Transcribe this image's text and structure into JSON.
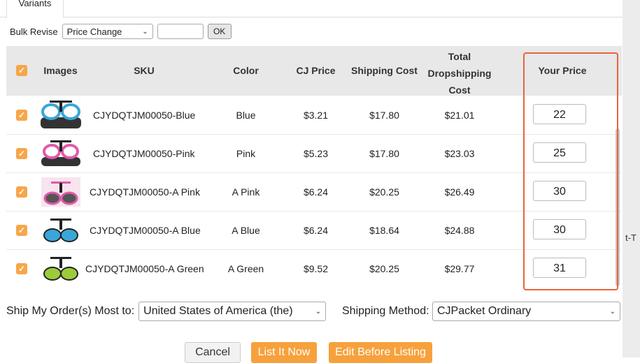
{
  "tabs": [
    {
      "label": "Variants"
    }
  ],
  "bulk": {
    "label": "Bulk Revise",
    "select_value": "Price Change",
    "input_value": "",
    "ok_label": "OK"
  },
  "table": {
    "headers": {
      "images": "Images",
      "sku": "SKU",
      "color": "Color",
      "cj_price": "CJ Price",
      "shipping_cost": "Shipping Cost",
      "total_line1": "Total",
      "total_line2": "Dropshipping",
      "total_line3": "Cost",
      "your_price": "Your Price"
    },
    "rows": [
      {
        "sku": "CJYDQTJM00050-Blue",
        "color": "Blue",
        "cj_price": "$3.21",
        "shipping": "$17.80",
        "total": "$21.01",
        "your_price": "22",
        "tint": "#3aa6d8"
      },
      {
        "sku": "CJYDQTJM00050-Pink",
        "color": "Pink",
        "cj_price": "$5.23",
        "shipping": "$17.80",
        "total": "$23.03",
        "your_price": "25",
        "tint": "#e05aa8"
      },
      {
        "sku": "CJYDQTJM00050-A Pink",
        "color": "A Pink",
        "cj_price": "$6.24",
        "shipping": "$20.25",
        "total": "$26.49",
        "your_price": "30",
        "tint": "#e05aa8"
      },
      {
        "sku": "CJYDQTJM00050-A Blue",
        "color": "A Blue",
        "cj_price": "$6.24",
        "shipping": "$18.64",
        "total": "$24.88",
        "your_price": "30",
        "tint": "#3aa6d8"
      },
      {
        "sku": "CJYDQTJM00050-A Green",
        "color": "A Green",
        "cj_price": "$9.52",
        "shipping": "$20.25",
        "total": "$29.77",
        "your_price": "31",
        "tint": "#9ccc3a"
      }
    ]
  },
  "shipping": {
    "dest_label": "Ship My Order(s) Most to:",
    "dest_value": "United States of America (the)",
    "method_label": "Shipping Method:",
    "method_value": "CJPacket Ordinary"
  },
  "buttons": {
    "cancel": "Cancel",
    "list_now": "List It Now",
    "edit_before": "Edit Before Listing"
  },
  "background_stub": "t-T",
  "colors": {
    "accent": "#f7a13c",
    "checkbox": "#f7a64a",
    "highlight": "#e8643a"
  }
}
